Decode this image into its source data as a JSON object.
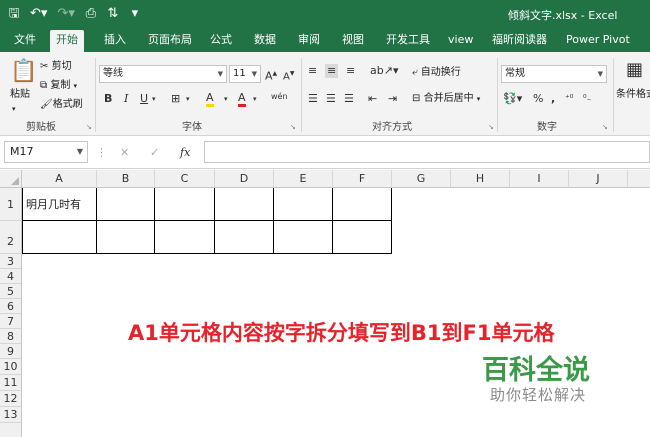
{
  "window": {
    "title": "倾斜文字.xlsx - Excel",
    "qat": [
      "save-icon",
      "undo-icon",
      "redo-icon",
      "print-preview-icon",
      "sort-icon",
      "customize-icon"
    ]
  },
  "tabs": [
    "文件",
    "开始",
    "插入",
    "页面布局",
    "公式",
    "数据",
    "审阅",
    "视图",
    "开发工具",
    "view",
    "福昕阅读器",
    "Power Pivot"
  ],
  "active_tab": "开始",
  "ribbon": {
    "clipboard": {
      "paste": "粘贴",
      "cut": "剪切",
      "copy": "复制",
      "format_painter": "格式刷",
      "label": "剪贴板"
    },
    "font": {
      "name": "等线",
      "size": "11",
      "grow": "A",
      "shrink": "A",
      "bold": "B",
      "italic": "I",
      "underline": "U",
      "border": "⊞",
      "fill": "A",
      "font_color": "A",
      "phonetic": "wén",
      "label": "字体"
    },
    "alignment": {
      "wrap_text": "自动换行",
      "merge_center": "合并后居中",
      "label": "对齐方式"
    },
    "number": {
      "format": "常规",
      "percent": "%",
      "comma": ",",
      "label": "数字"
    },
    "styles": {
      "conditional": "条件格式"
    }
  },
  "formula_bar": {
    "name_box": "M17",
    "cancel": "✕",
    "enter": "✓",
    "fx": "fx",
    "content": ""
  },
  "columns": [
    "A",
    "B",
    "C",
    "D",
    "E",
    "F",
    "G",
    "H",
    "I",
    "J"
  ],
  "rows": [
    "1",
    "2",
    "3",
    "4",
    "5",
    "6",
    "7",
    "8",
    "9",
    "10",
    "11",
    "12",
    "13"
  ],
  "cells": {
    "A1": "明月几时有"
  },
  "overlay_text": "A1单元格内容按字拆分填写到B1到F1单元格",
  "watermark": {
    "title": "百科全说",
    "subtitle": "助你轻松解决"
  },
  "colors": {
    "excel_green": "#217346",
    "overlay_red": "#e8222b",
    "watermark_green": "#3a9a47"
  }
}
